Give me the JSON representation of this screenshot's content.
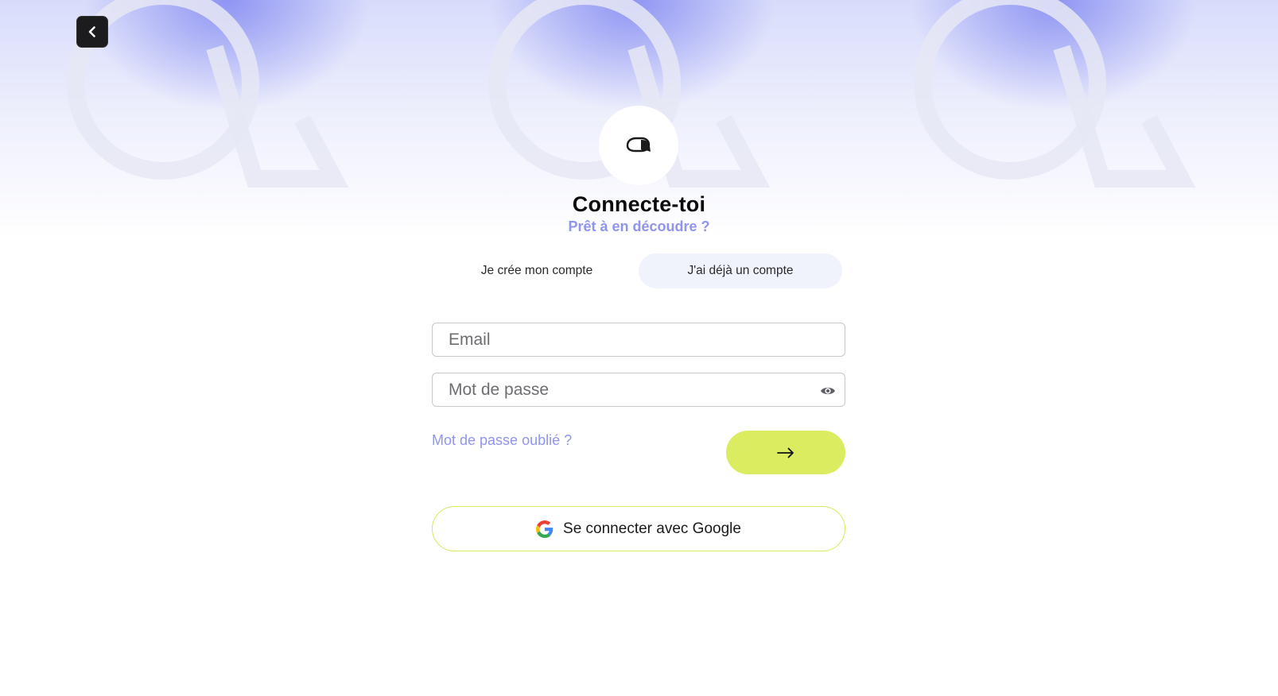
{
  "header": {
    "back_icon": "chevron-left-icon"
  },
  "logo": {
    "icon": "chat-bubble-icon"
  },
  "heading": {
    "title": "Connecte-toi",
    "subtitle": "Prêt à en découdre ?"
  },
  "tabs": [
    {
      "label": "Je crée mon compte",
      "active": false
    },
    {
      "label": "J'ai déjà un compte",
      "active": true
    }
  ],
  "form": {
    "email_placeholder": "Email",
    "password_placeholder": "Mot de passe",
    "password_toggle_icon": "eye-icon",
    "forgot_label": "Mot de passe oublié ?",
    "submit_icon": "arrow-right-icon",
    "google_label": "Se connecter avec Google",
    "google_icon": "google-icon"
  },
  "colors": {
    "accent_purple": "#8f95ee",
    "accent_lime": "#dcec60",
    "dark": "#1c1c1e"
  }
}
